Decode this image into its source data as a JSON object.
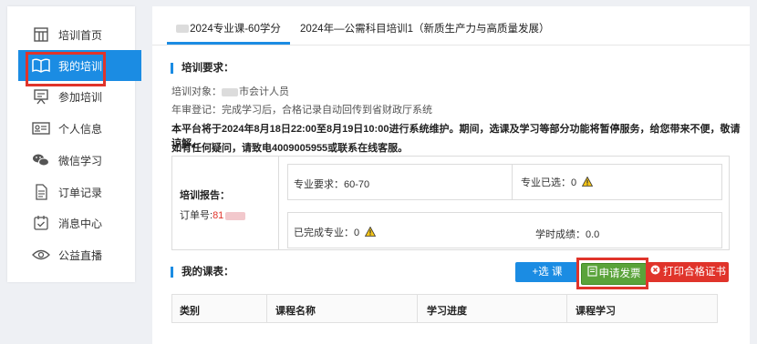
{
  "sidebar": {
    "items": [
      {
        "label": "培训首页",
        "icon": "training-home-icon"
      },
      {
        "label": "我的培训",
        "icon": "open-book-icon"
      },
      {
        "label": "参加培训",
        "icon": "presentation-icon"
      },
      {
        "label": "个人信息",
        "icon": "id-card-icon"
      },
      {
        "label": "微信学习",
        "icon": "wechat-icon"
      },
      {
        "label": "订单记录",
        "icon": "document-icon"
      },
      {
        "label": "消息中心",
        "icon": "message-check-icon"
      },
      {
        "label": "公益直播",
        "icon": "eye-icon"
      }
    ],
    "active_index": 1
  },
  "tabs": [
    {
      "label": "2024专业课-60学分"
    },
    {
      "label": "2024年—公需科目培训1（新质生产力与高质量发展）"
    }
  ],
  "requirements": {
    "title": "培训要求：",
    "target_label": "培训对象：",
    "target_value": "市会计人员",
    "registration": "年审登记：完成学习后，合格记录自动回传到省财政厅系统",
    "notice_line1": "本平台将于2024年8月18日22:00至8月19日10:00进行系统维护。期间，选课及学习等部分功能将暂停服务，给您带来不便，敬请谅解。",
    "notice_line2": "如有任何疑问，请致电4009005955或联系在线客服。"
  },
  "report": {
    "title": "培训报告：",
    "order_label": "订单号:",
    "order_value": "81",
    "major_required": "专业要求：60-70",
    "major_selected": "专业已选：0",
    "major_completed": "已完成专业：0",
    "hours_score": "学时成绩：0.0"
  },
  "courses": {
    "title": "我的课表：",
    "select_button": "+选 课",
    "invoice_button": "申请发票",
    "cert_button": "打印合格证书",
    "columns": [
      "类别",
      "课程名称",
      "学习进度",
      "课程学习"
    ]
  },
  "colors": {
    "accent": "#1b8ce3",
    "invoice_green": "#5aa33a",
    "cert_red": "#e0342b",
    "highlight_red": "#e0342b"
  }
}
